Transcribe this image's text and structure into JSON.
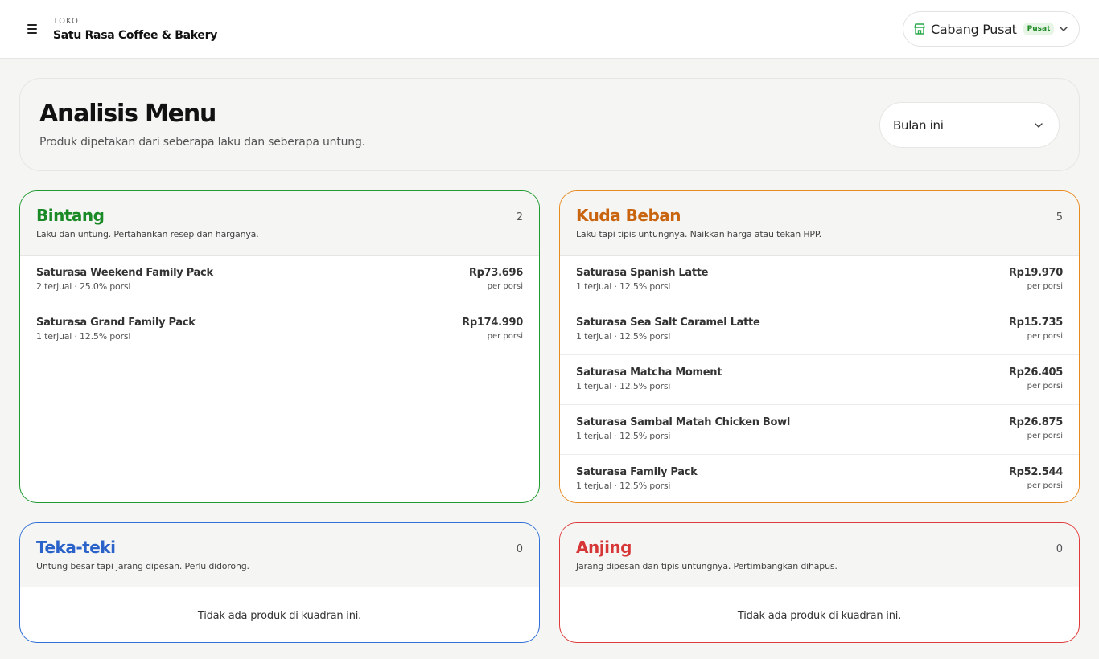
{
  "store": {
    "label": "TOKO",
    "name": "Satu Rasa Coffee & Bakery"
  },
  "branch": {
    "name": "Cabang Pusat",
    "badge": "Pusat"
  },
  "page": {
    "title": "Analisis Menu",
    "subtitle": "Produk dipetakan dari seberapa laku dan seberapa untung.",
    "period": "Bulan ini"
  },
  "colors": {
    "bintang": "#1f9a2f",
    "kuda_beban": "#e98a1e",
    "teka_teki": "#2f6fd6",
    "anjing": "#e03a3a"
  },
  "quadrants": {
    "bintang": {
      "title": "Bintang",
      "desc": "Laku dan untung. Pertahankan resep dan harganya.",
      "count": "2",
      "items": [
        {
          "name": "Saturasa Weekend Family Pack",
          "meta": "2 terjual · 25.0% porsi",
          "price": "Rp73.696",
          "unit": "per porsi"
        },
        {
          "name": "Saturasa Grand Family Pack",
          "meta": "1 terjual · 12.5% porsi",
          "price": "Rp174.990",
          "unit": "per porsi"
        }
      ]
    },
    "kuda_beban": {
      "title": "Kuda Beban",
      "desc": "Laku tapi tipis untungnya. Naikkan harga atau tekan HPP.",
      "count": "5",
      "items": [
        {
          "name": "Saturasa Spanish Latte",
          "meta": "1 terjual · 12.5% porsi",
          "price": "Rp19.970",
          "unit": "per porsi"
        },
        {
          "name": "Saturasa Sea Salt Caramel Latte",
          "meta": "1 terjual · 12.5% porsi",
          "price": "Rp15.735",
          "unit": "per porsi"
        },
        {
          "name": "Saturasa Matcha Moment",
          "meta": "1 terjual · 12.5% porsi",
          "price": "Rp26.405",
          "unit": "per porsi"
        },
        {
          "name": "Saturasa Sambal Matah Chicken Bowl",
          "meta": "1 terjual · 12.5% porsi",
          "price": "Rp26.875",
          "unit": "per porsi"
        },
        {
          "name": "Saturasa Family Pack",
          "meta": "1 terjual · 12.5% porsi",
          "price": "Rp52.544",
          "unit": "per porsi"
        }
      ]
    },
    "teka_teki": {
      "title": "Teka-teki",
      "desc": "Untung besar tapi jarang dipesan. Perlu didorong.",
      "count": "0",
      "empty": "Tidak ada produk di kuadran ini."
    },
    "anjing": {
      "title": "Anjing",
      "desc": "Jarang dipesan dan tipis untungnya. Pertimbangkan dihapus.",
      "count": "0",
      "empty": "Tidak ada produk di kuadran ini."
    }
  }
}
